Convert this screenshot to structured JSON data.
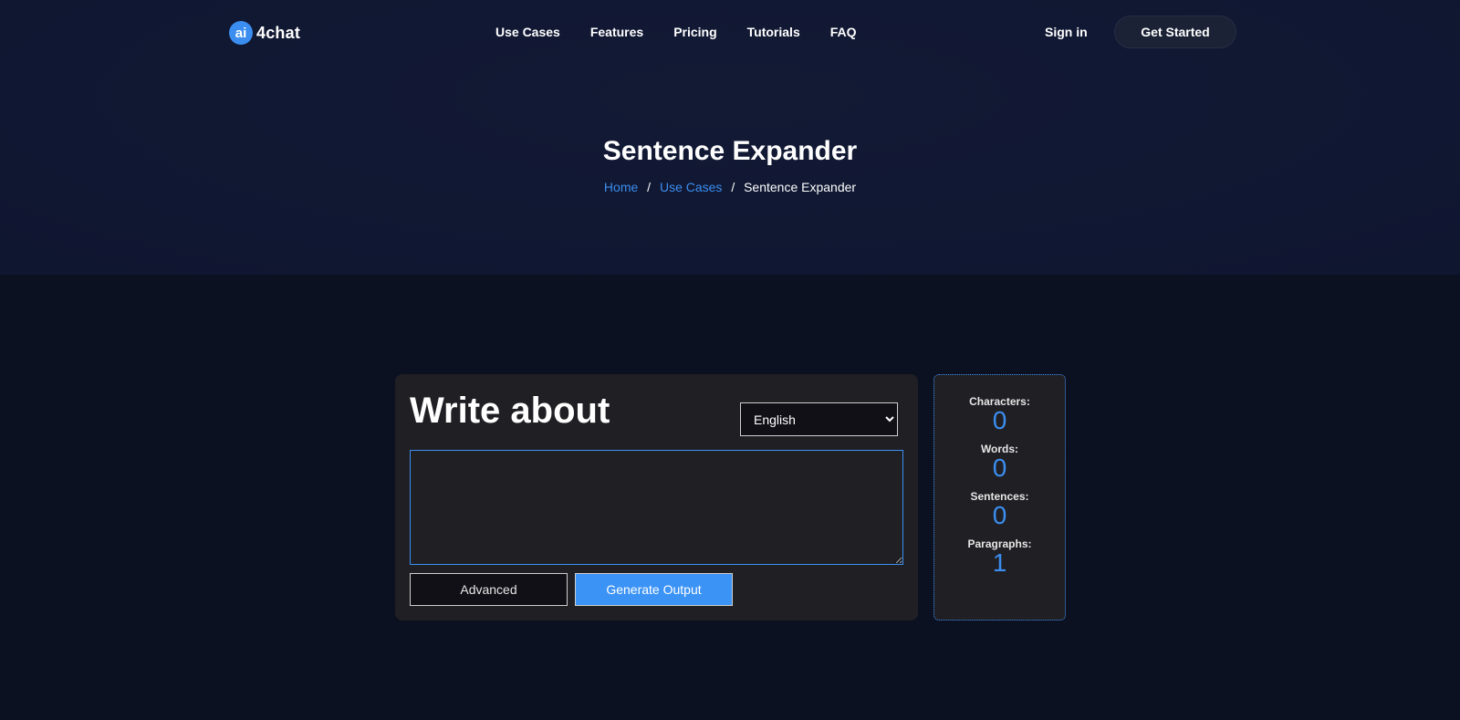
{
  "header": {
    "logo_badge": "ai",
    "logo_text": "4chat",
    "nav": [
      "Use Cases",
      "Features",
      "Pricing",
      "Tutorials",
      "FAQ"
    ],
    "sign_in": "Sign in",
    "get_started": "Get Started"
  },
  "hero": {
    "title": "Sentence Expander",
    "breadcrumb": [
      {
        "label": "Home"
      },
      {
        "label": "Use Cases"
      },
      {
        "label": "Sentence Expander"
      }
    ],
    "separator": "/"
  },
  "editor": {
    "title": "Write about",
    "language_selected": "English",
    "textarea_value": "",
    "advanced_label": "Advanced",
    "generate_label": "Generate Output"
  },
  "stats": [
    {
      "label": "Characters:",
      "value": "0"
    },
    {
      "label": "Words:",
      "value": "0"
    },
    {
      "label": "Sentences:",
      "value": "0"
    },
    {
      "label": "Paragraphs:",
      "value": "1"
    }
  ],
  "colors": {
    "accent": "#3b8ef0",
    "background": "#0b1120",
    "card": "#201f24"
  }
}
